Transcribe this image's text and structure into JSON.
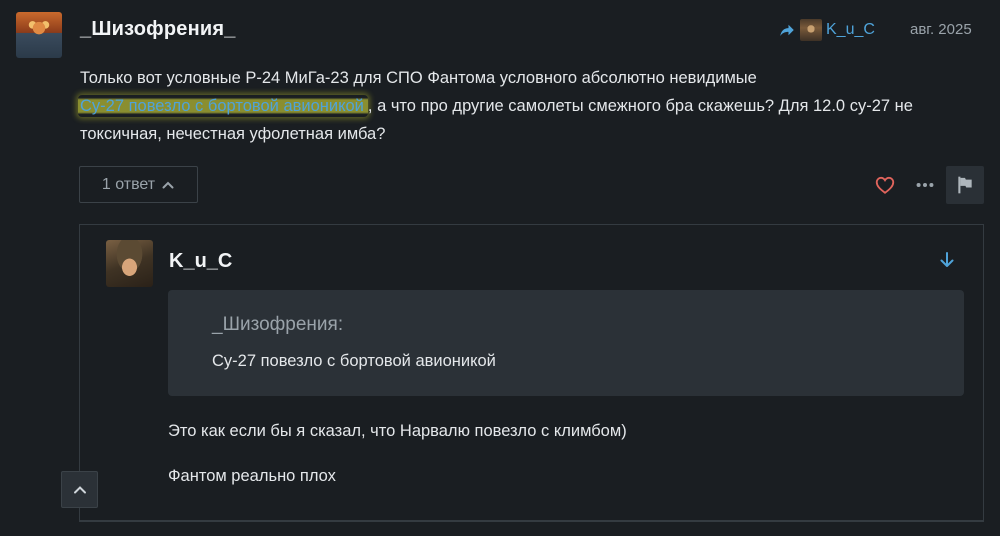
{
  "post": {
    "username": "_Шизофрения_",
    "reply_to_username": "K_u_C",
    "date": "авг. 2025",
    "body_line1": "Только вот условные Р-24 МиГа-23 для СПО Фантома условного абсолютно невидимые",
    "quoted_link": "Су-27 повезло с бортовой авионикой",
    "body_rest_line2": ", а что про другие самолеты смежного бра скажешь? Для 12.0 су-27 не",
    "body_line3": "токсичная, нечестная уфолетная имба?",
    "replies_label": "1 ответ",
    "colors": {
      "accent": "#4fa3d9",
      "highlight": "#e6eb3c",
      "like_heart": "#e0645c",
      "background": "#1a1e22"
    },
    "icons": {
      "reply_to": "reply-arrow-icon",
      "replies_toggle": "chevron-up-icon",
      "like": "heart-icon",
      "more": "more-dots-icon",
      "flag": "flag-icon"
    }
  },
  "reply": {
    "username": "K_u_C",
    "quote_author": "_Шизофрения:",
    "quote_text": "Су-27 повезло с бортовой авионикой",
    "paragraphs": [
      "Это как если бы я сказал, что Нарвалю повезло с климбом)",
      "Фантом реально плох"
    ],
    "icons": {
      "jump": "arrow-down-icon",
      "scroll_top": "chevron-up-icon"
    }
  }
}
